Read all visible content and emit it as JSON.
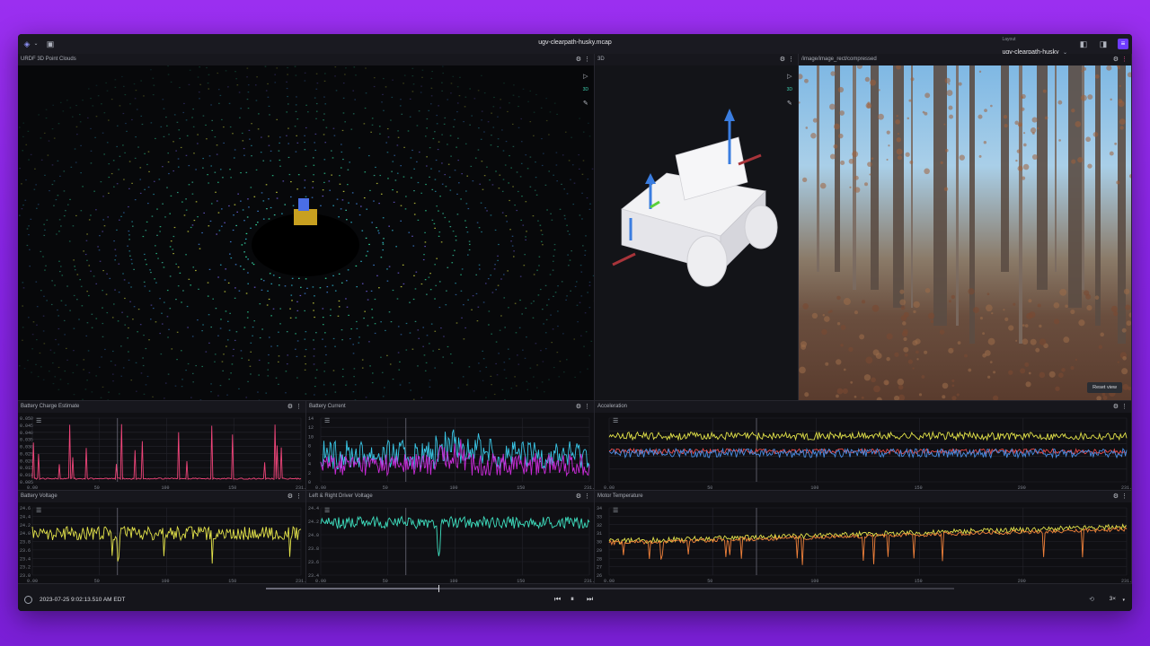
{
  "app": {
    "title": "ugv-clearpath-husky.mcap",
    "layout_label": "Layout",
    "layout_value": "ugv-clearpath-husky"
  },
  "colors": {
    "background": "#8a25e8",
    "accent": "#6e3bff",
    "pink": "#f0457a",
    "cyan": "#39c6e6",
    "magenta": "#c92bd8",
    "yellow": "#e3e34a",
    "teal": "#3ee0c0",
    "orange": "#f0813a",
    "blue": "#4a8ee6",
    "red": "#e84a4a"
  },
  "panels": {
    "pointcloud": {
      "title": "URDF 3D Point Clouds"
    },
    "model3d": {
      "title": "3D",
      "mode": "3D"
    },
    "image": {
      "title": "/image/image_rect/compressed",
      "reset_label": "Reset view"
    },
    "battery_charge": {
      "title": "Battery Charge Estimate",
      "y_ticks": [
        "0.050",
        "0.045",
        "0.040",
        "0.035",
        "0.030",
        "0.025",
        "0.020",
        "0.015",
        "0.010",
        "0.005"
      ],
      "x_ticks": [
        "0.00",
        "50",
        "100",
        "150",
        "231.00"
      ]
    },
    "battery_current": {
      "title": "Battery Current",
      "y_ticks": [
        "14",
        "12",
        "10",
        "8",
        "6",
        "4",
        "2",
        "0"
      ],
      "x_ticks": [
        "0.00",
        "50",
        "100",
        "150",
        "231.00"
      ]
    },
    "acceleration": {
      "title": "Acceleration",
      "x_ticks": [
        "0.00",
        "50",
        "100",
        "150",
        "200",
        "231.00"
      ]
    },
    "battery_voltage": {
      "title": "Battery Voltage",
      "y_ticks": [
        "24.6",
        "24.4",
        "24.2",
        "24.0",
        "23.8",
        "23.6",
        "23.4",
        "23.2",
        "23.0"
      ],
      "x_ticks": [
        "0.00",
        "50",
        "100",
        "150",
        "231.00"
      ]
    },
    "driver_voltage": {
      "title": "Left & Right Driver Voltage",
      "y_ticks": [
        "24.4",
        "24.2",
        "24.0",
        "23.8",
        "23.6",
        "23.4"
      ],
      "x_ticks": [
        "0.00",
        "50",
        "100",
        "150",
        "231.00"
      ]
    },
    "motor_temp": {
      "title": "Motor Temperature",
      "y_ticks": [
        "34",
        "33",
        "32",
        "31",
        "30",
        "29",
        "28",
        "27",
        "26"
      ],
      "x_ticks": [
        "0.00",
        "50",
        "100",
        "150",
        "200",
        "231.00"
      ]
    }
  },
  "playback": {
    "timestamp": "2023-07-25 9:02:13.510 AM EDT",
    "speed": "3×",
    "progress": 0.25
  },
  "icons": {
    "gear": "⚙",
    "menu": "⋮",
    "legend": "☰",
    "select": "▷",
    "ruler": "✎",
    "prev": "⏮",
    "pause": "⏸",
    "next": "⏭",
    "loop": "⟲"
  }
}
